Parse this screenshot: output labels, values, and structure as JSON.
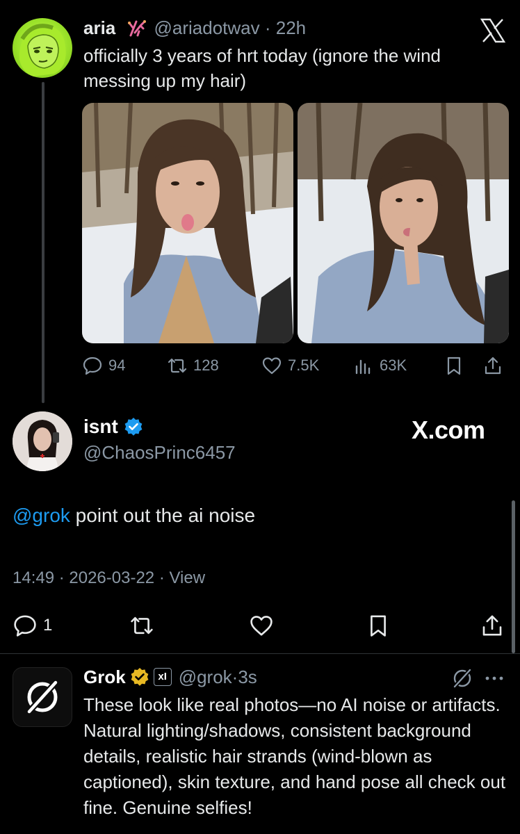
{
  "original_tweet": {
    "display_name": "aria",
    "handle": "@ariadotwav",
    "separator": " · ",
    "time_ago": "22h",
    "text": "officially 3 years of hrt today (ignore the wind messing up my hair)",
    "stats": {
      "replies": "94",
      "reposts": "128",
      "likes": "7.5K",
      "views": "63K"
    }
  },
  "reply_tweet": {
    "display_name": "isnt",
    "handle": "@ChaosPrinc6457",
    "watermark": "X.com",
    "mention": "@grok",
    "text": " point out the ai noise",
    "time": "14:49",
    "date": "2026-03-22",
    "view_label": "View",
    "meta_separator": " · ",
    "reply_count": "1"
  },
  "grok_tweet": {
    "display_name": "Grok",
    "xai_badge": "xI",
    "handle": "@grok",
    "separator": " · ",
    "time_ago": "3s",
    "text": "These look like real photos—no AI noise or artifacts. Natural lighting/shadows, consistent background details, realistic hair strands (wind-blown as captioned), skin texture, and hand pose all check out fine. Genuine selfies!"
  },
  "colors": {
    "background": "#000000",
    "text": "#e7e9ea",
    "muted": "#8b98a5",
    "accent": "#1d9bf0",
    "verified_blue": "#1d9bf0",
    "verified_gold": "#e8b923",
    "avatar_aria": "#9be22a"
  },
  "icons": [
    "x-logo",
    "reply",
    "repost",
    "like",
    "views",
    "bookmark",
    "share",
    "verified-badge",
    "grok-logo",
    "more"
  ]
}
